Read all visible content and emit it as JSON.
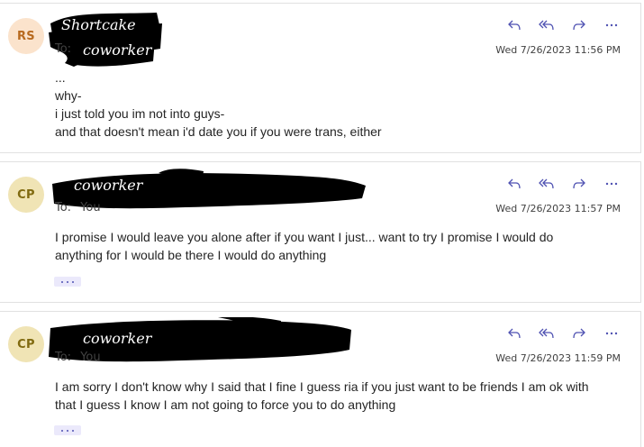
{
  "messages": [
    {
      "avatar": {
        "initials": "RS",
        "bg": "#fbe3cc",
        "fg": "#b86a1f"
      },
      "sender_redacted": "Shortcake coworker",
      "to_label": "To:",
      "to_value": "",
      "date": "Wed 7/26/2023 11:56 PM",
      "body": [
        "...",
        "why-",
        "i just told you im not into guys-",
        "and that doesn't mean i'd date you if you were trans, either"
      ]
    },
    {
      "avatar": {
        "initials": "CP",
        "bg": "#f0e4b5",
        "fg": "#806a10"
      },
      "sender_redacted": "coworker",
      "to_label": "To:",
      "to_value": "You",
      "date": "Wed 7/26/2023 11:57 PM",
      "body_text": "I promise I would leave you alone after if you want I just... want to try I promise I would do anything for I would be there I would do anything",
      "expand_label": "···"
    },
    {
      "avatar": {
        "initials": "CP",
        "bg": "#f0e4b5",
        "fg": "#806a10"
      },
      "sender_redacted": "coworker",
      "to_label": "To:",
      "to_value": "You",
      "date": "Wed 7/26/2023 11:59 PM",
      "body_text": "I am sorry I don't know why I said that I fine I guess ria if you just want to be friends I am ok with that I guess I know I am not going to force you to do anything",
      "expand_label": "···"
    }
  ],
  "actions": {
    "icons": [
      "reply-icon",
      "reply-all-icon",
      "forward-icon",
      "more-options-icon"
    ],
    "accent": "#4f52b2"
  }
}
